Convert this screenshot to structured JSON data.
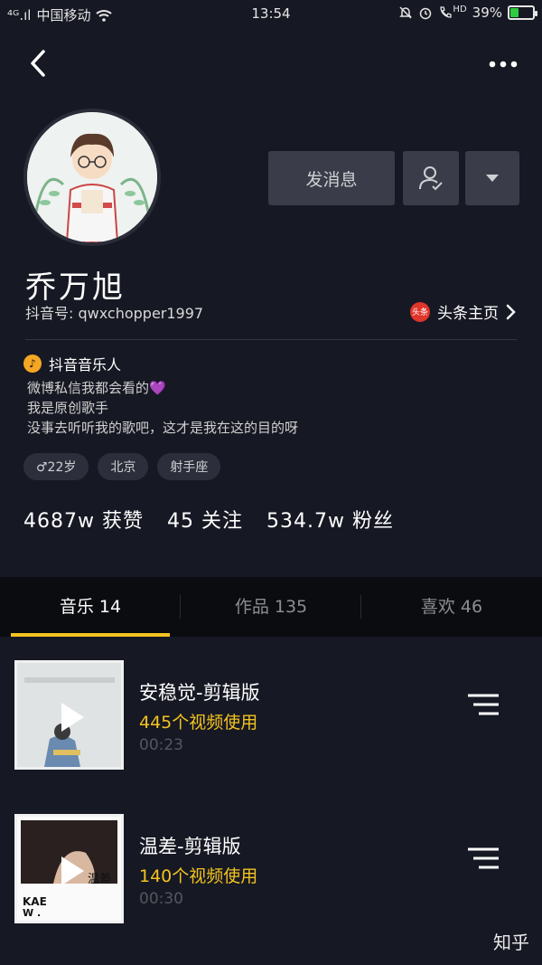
{
  "status_bar": {
    "signal": "⁴ᴳ.ıl",
    "carrier": "中国移动",
    "time": "13:54",
    "hd": "HD",
    "battery": "39%",
    "battery_level": 0.39,
    "battery_color": "#2ecc40"
  },
  "nav": {
    "back_icon": "chevron-left-icon",
    "more_icon": "more-dots-icon"
  },
  "profile": {
    "name": "乔万旭",
    "douyin_id": "抖音号: qwxchopper1997",
    "toutiao_badge": "头条",
    "toutiao_link": "头条主页",
    "musician_label": "抖音音乐人",
    "bio": [
      "微博私信我都会看的💜",
      "我是原创歌手",
      "没事去听听我的歌吧，这才是我在这的目的呀"
    ],
    "tags": [
      "♂22岁",
      "北京",
      "射手座"
    ],
    "stats": [
      "4687w 获赞",
      "45 关注",
      "534.7w 粉丝"
    ]
  },
  "actions": {
    "message": "发消息"
  },
  "tabs": [
    {
      "label": "音乐 14"
    },
    {
      "label": "作品 135"
    },
    {
      "label": "喜欢 46"
    }
  ],
  "songs": [
    {
      "title": "安稳觉-剪辑版",
      "uses": "445个视频使用",
      "duration": "00:23"
    },
    {
      "title": "温差-剪辑版",
      "uses": "140个视频使用",
      "duration": "00:30",
      "cover_text": "温差"
    }
  ],
  "watermark": "知乎",
  "colors": {
    "background": "#161823",
    "accent": "#f4c320",
    "toutiao_red": "#e0352b",
    "musician_orange": "#f5a623"
  }
}
